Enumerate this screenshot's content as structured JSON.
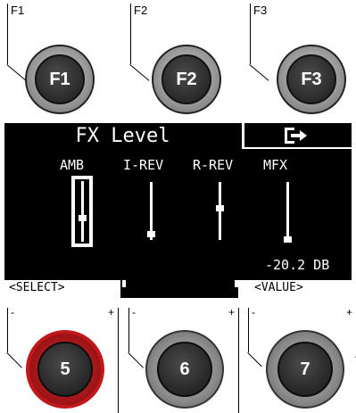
{
  "function_keys": [
    {
      "label": "F1",
      "button": "F1"
    },
    {
      "label": "F2",
      "button": "F2"
    },
    {
      "label": "F3",
      "button": "F3"
    }
  ],
  "lcd": {
    "title": "FX Level",
    "exit_icon": "exit-arrow-icon",
    "channels": [
      {
        "label": "AMB",
        "level": 0.35,
        "selected": true
      },
      {
        "label": "I-REV",
        "level": 0.1
      },
      {
        "label": "R-REV",
        "level": 0.55
      },
      {
        "label": "MFX",
        "level": 0.05
      }
    ],
    "value_readout": "-20.2 DB",
    "softkeys": {
      "left": "<SELECT>",
      "right": "<VALUE>"
    }
  },
  "encoders": [
    {
      "label": "5",
      "minus": "-",
      "plus": "+",
      "active": true,
      "accent": "#c0181b"
    },
    {
      "label": "6",
      "minus": "-",
      "plus": "+",
      "active": false
    },
    {
      "label": "7",
      "minus": "-",
      "plus": "+",
      "active": false
    }
  ]
}
